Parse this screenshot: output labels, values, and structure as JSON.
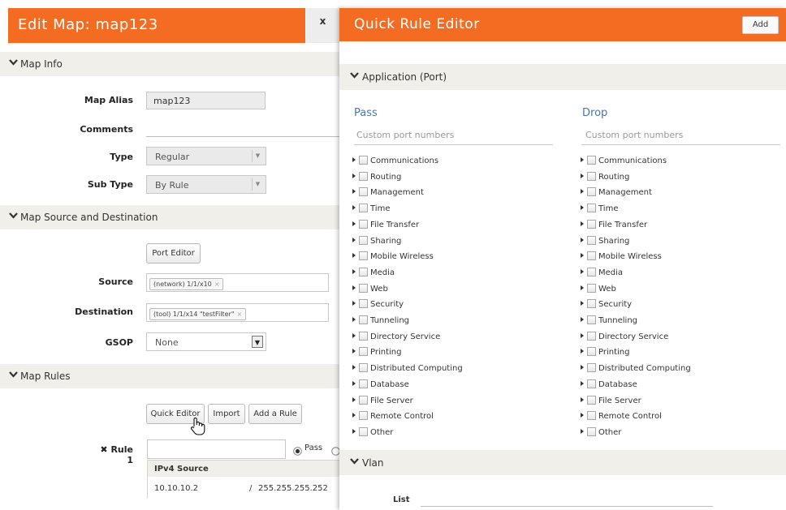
{
  "edit_map": {
    "title": "Edit Map: map123",
    "close_label": "x",
    "map_info": {
      "section_label": "Map Info",
      "alias_label": "Map Alias",
      "alias_value": "map123",
      "comments_label": "Comments",
      "comments_value": "",
      "type_label": "Type",
      "type_value": "Regular",
      "subtype_label": "Sub Type",
      "subtype_value": "By Rule"
    },
    "source_dest": {
      "section_label": "Map Source and Destination",
      "port_editor_label": "Port Editor",
      "source_label": "Source",
      "source_tag": "(network) 1/1/x10",
      "destination_label": "Destination",
      "destination_tag": "(tool) 1/1/x14 \"testFilter\"",
      "gsop_label": "GSOP",
      "gsop_value": "None"
    },
    "map_rules": {
      "section_label": "Map Rules",
      "quick_editor_label": "Quick Editor",
      "import_label": "Import",
      "add_rule_label": "Add a Rule",
      "rule_label": "Rule 1",
      "rule_remove_icon": "x-icon",
      "rule_pass_label": "Pass",
      "ipv4_header": "IPv4 Source",
      "ipv4_address": "10.10.10.2",
      "ipv4_sep": "/",
      "ipv4_mask": "255.255.255.252"
    }
  },
  "quick_rule_editor": {
    "title": "Quick Rule Editor",
    "add_label": "Add",
    "application_section_label": "Application (Port)",
    "pass": {
      "title": "Pass",
      "placeholder": "Custom port numbers"
    },
    "drop": {
      "title": "Drop",
      "placeholder": "Custom port numbers"
    },
    "categories": [
      "Communications",
      "Routing",
      "Management",
      "Time",
      "File Transfer",
      "Sharing",
      "Mobile Wireless",
      "Media",
      "Web",
      "Security",
      "Tunneling",
      "Directory Service",
      "Printing",
      "Distributed Computing",
      "Database",
      "File Server",
      "Remote Control",
      "Other"
    ],
    "vlan_section_label": "Vlan",
    "vlan_list_label": "List"
  },
  "colors": {
    "header_orange": "#f36c21",
    "section_bg": "#f0efe9",
    "link_blue": "#4a78a8"
  },
  "icons": {
    "chevron": "chevron-down-icon",
    "expand": "triangle-right-icon",
    "cursor": "hand-pointer-icon"
  }
}
